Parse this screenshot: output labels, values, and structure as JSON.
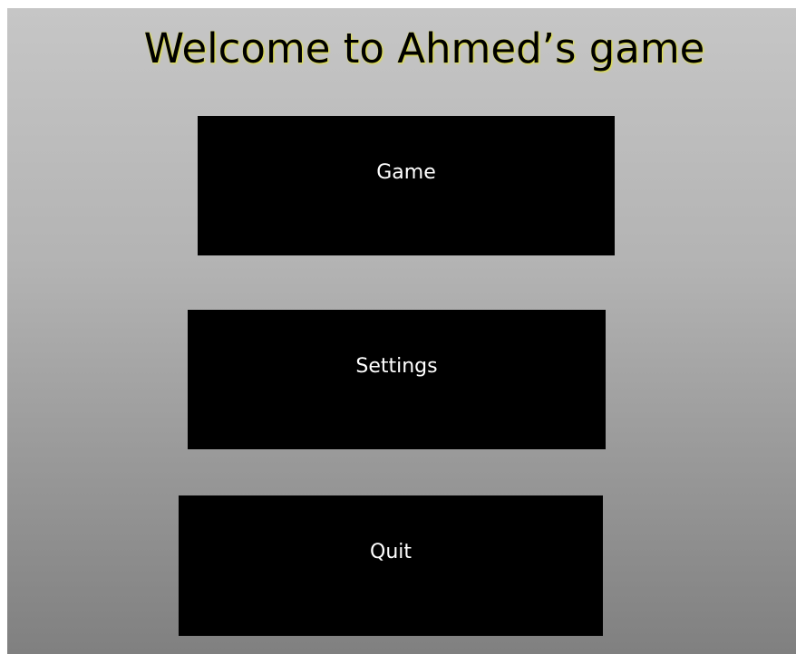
{
  "title": "Welcome to Ahmed’s game",
  "menu": {
    "game_label": "Game",
    "settings_label": "Settings",
    "quit_label": "Quit"
  },
  "colors": {
    "button_background": "#000000",
    "button_text": "#ffffff",
    "title_text": "#000000",
    "title_glow": "#e6e62a",
    "background_top": "#c6c6c6",
    "background_bottom": "#808080"
  }
}
